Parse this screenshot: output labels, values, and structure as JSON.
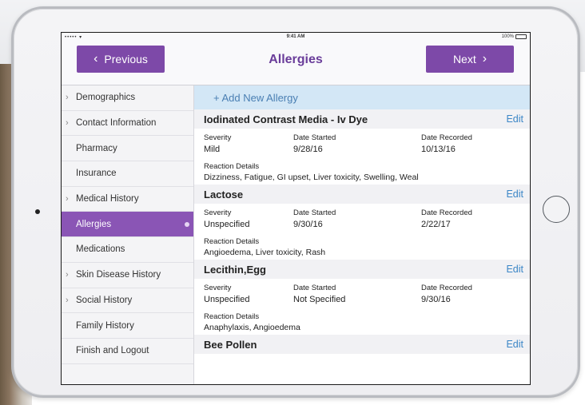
{
  "status_bar": {
    "signal": "••••• ▾",
    "time": "9:41 AM",
    "battery_percent": "100%"
  },
  "nav": {
    "prev_label": "Previous",
    "next_label": "Next",
    "title": "Allergies"
  },
  "sidebar": {
    "items": [
      {
        "label": "Demographics",
        "has_arrow": true,
        "active": false
      },
      {
        "label": "Contact Information",
        "has_arrow": true,
        "active": false
      },
      {
        "label": "Pharmacy",
        "has_arrow": false,
        "active": false
      },
      {
        "label": "Insurance",
        "has_arrow": false,
        "active": false
      },
      {
        "label": "Medical History",
        "has_arrow": true,
        "active": false
      },
      {
        "label": "Allergies",
        "has_arrow": false,
        "active": true
      },
      {
        "label": "Medications",
        "has_arrow": false,
        "active": false
      },
      {
        "label": "Skin Disease History",
        "has_arrow": true,
        "active": false
      },
      {
        "label": "Social History",
        "has_arrow": true,
        "active": false
      },
      {
        "label": "Family History",
        "has_arrow": false,
        "active": false
      },
      {
        "label": "Finish and Logout",
        "has_arrow": false,
        "active": false
      }
    ]
  },
  "main": {
    "add_label": "+ Add New Allergy",
    "edit_label": "Edit",
    "col_labels": {
      "severity": "Severity",
      "date_started": "Date Started",
      "date_recorded": "Date Recorded",
      "reaction": "Reaction Details"
    },
    "allergies": [
      {
        "name": "Iodinated Contrast Media - Iv Dye",
        "severity": "Mild",
        "date_started": "9/28/16",
        "date_recorded": "10/13/16",
        "reaction": "Dizziness, Fatigue, GI upset, Liver toxicity, Swelling, Weal"
      },
      {
        "name": "Lactose",
        "severity": "Unspecified",
        "date_started": "9/30/16",
        "date_recorded": "2/22/17",
        "reaction": "Angioedema, Liver toxicity, Rash"
      },
      {
        "name": "Lecithin,Egg",
        "severity": "Unspecified",
        "date_started": "Not Specified",
        "date_recorded": "9/30/16",
        "reaction": "Anaphylaxis, Angioedema"
      },
      {
        "name": "Bee Pollen"
      }
    ]
  },
  "colors": {
    "accent_purple": "#7d49a8",
    "title_purple": "#6a3d9a",
    "active_item": "#8a55b5",
    "add_row_bg": "#d3e7f6",
    "link_blue": "#3b86c7"
  }
}
